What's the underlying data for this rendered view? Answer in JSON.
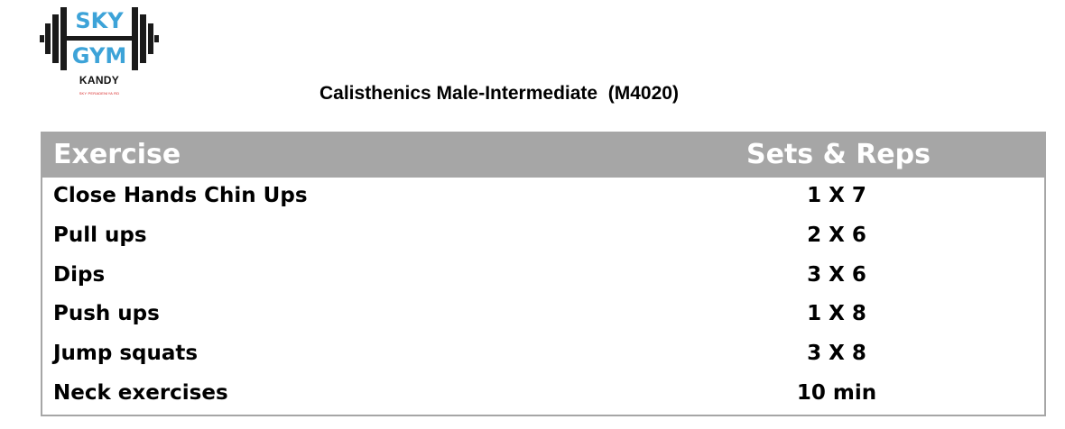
{
  "logo": {
    "line1": "SKY",
    "line2": "GYM",
    "location": "KANDY",
    "tagline": "SKY PERADENIYA RD",
    "colors": {
      "text_blue": "#3da3d8",
      "weights": "#1a1a1a"
    }
  },
  "title": "Calisthenics Male-Intermediate  (M4020)",
  "table": {
    "header_bg": "#a6a6a6",
    "columns": {
      "exercise": "Exercise",
      "sets_reps": "Sets & Reps"
    },
    "rows": [
      {
        "exercise": "Close Hands Chin Ups",
        "sets_reps": "1 X 7"
      },
      {
        "exercise": "Pull ups",
        "sets_reps": "2 X 6"
      },
      {
        "exercise": "Dips",
        "sets_reps": "3 X 6"
      },
      {
        "exercise": "Push ups",
        "sets_reps": "1 X 8"
      },
      {
        "exercise": "Jump squats",
        "sets_reps": "3 X 8"
      },
      {
        "exercise": "Neck exercises",
        "sets_reps": "10 min"
      }
    ]
  }
}
